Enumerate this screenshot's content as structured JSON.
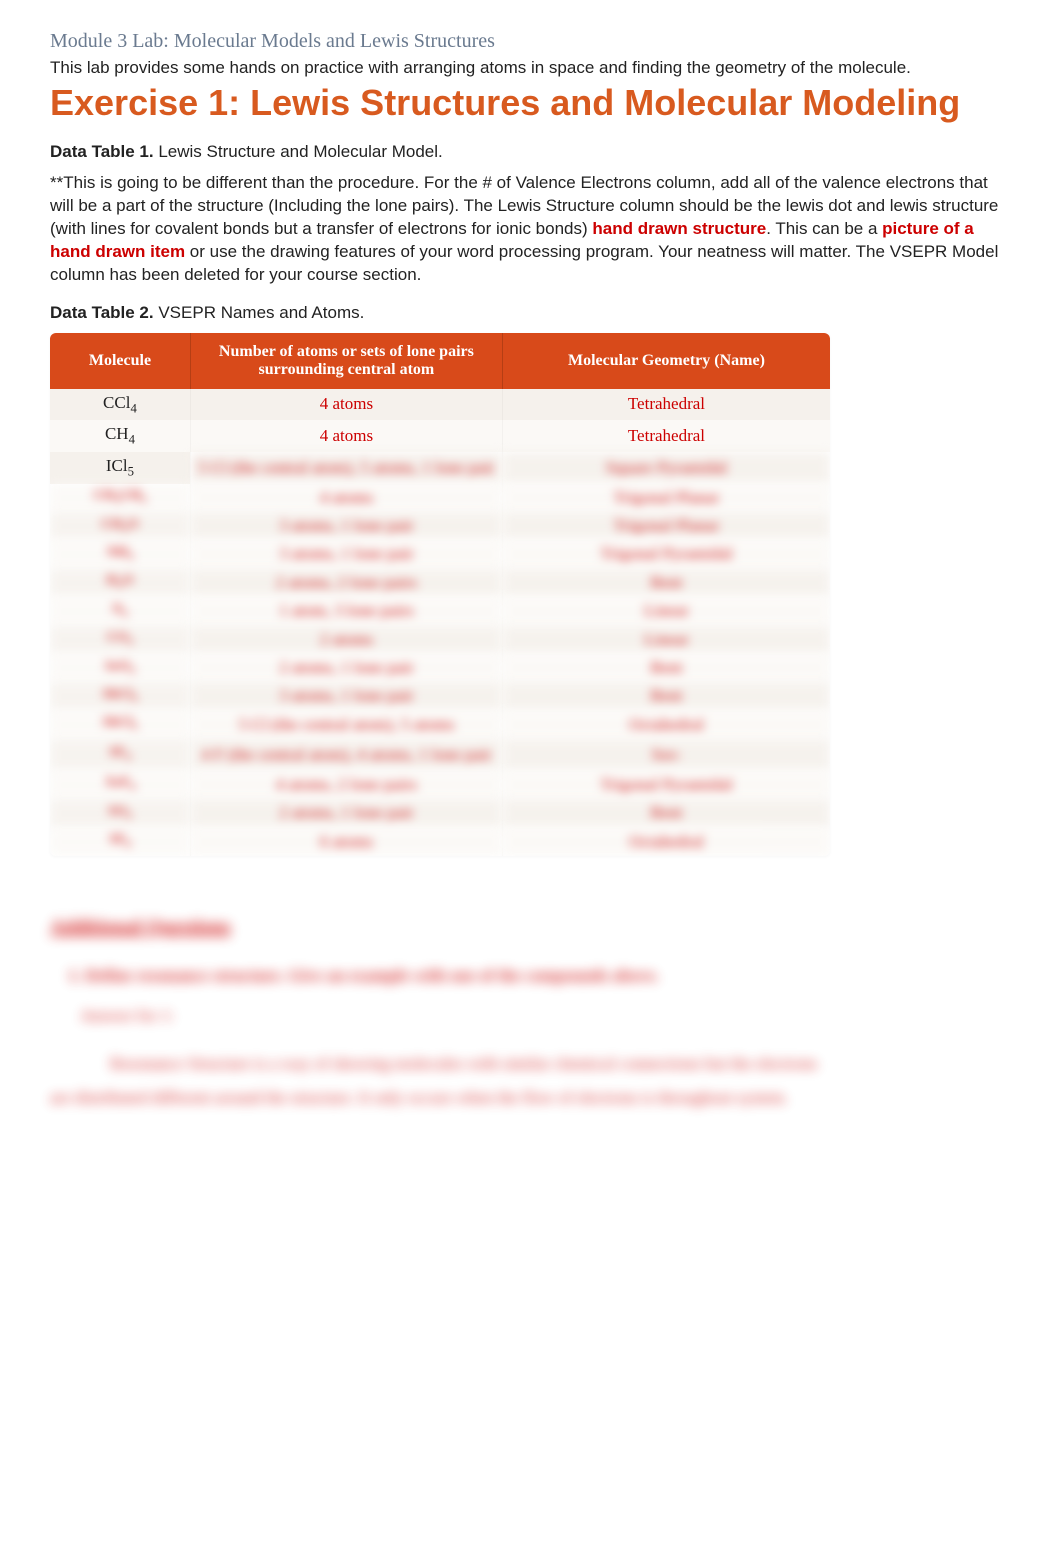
{
  "module_title": "Module 3 Lab: Molecular Models and Lewis Structures",
  "intro": "This lab provides some hands on practice with arranging atoms in space and finding the geometry of the molecule.",
  "exercise_title": "Exercise 1: Lewis Structures and Molecular Modeling",
  "table1_caption_bold": "Data Table 1.",
  "table1_caption_rest": " Lewis Structure and Molecular Model.",
  "instructions_pre": "**This is going to be different than the procedure. For the # of Valence Electrons column, add all of the valence electrons that will be a part of the structure (Including the lone pairs). The Lewis Structure column should be the lewis dot and lewis structure (with lines for covalent bonds but a transfer of electrons for ionic bonds) ",
  "instructions_red1": "hand drawn structure",
  "instructions_mid1": ". This can be a ",
  "instructions_red2": "picture of a hand drawn item",
  "instructions_post": " or use the drawing features of your word processing program. Your neatness will matter.  The VSEPR Model column has been deleted for your course section.",
  "table2_caption_bold": "Data Table 2.",
  "table2_caption_rest": " VSEPR Names and Atoms.",
  "headers": {
    "molecule": "Molecule",
    "number": "Number of atoms or sets of lone pairs surrounding central atom",
    "geometry": "Molecular Geometry  (Name)"
  },
  "rows": [
    {
      "mol_html": "CCl<sub>4</sub>",
      "num": "4 atoms",
      "geo": "Tetrahedral",
      "blurred": false
    },
    {
      "mol_html": "CH<sub>4</sub>",
      "num": "4 atoms",
      "geo": "Tetrahedral",
      "blurred": false
    },
    {
      "mol_html": "ICl<sub>5</sub>",
      "num": "5 Cl (the central atom), 5 atoms, 1 lone pair",
      "geo": "Square Pyramidal",
      "blurred": true,
      "mol_visible": true,
      "two_line": true
    },
    {
      "mol_html": "CH<sub>3</sub>CH<sub>2</sub>",
      "num": "4 atoms",
      "geo": "Trigonal Planar",
      "blurred": true
    },
    {
      "mol_html": "CH<sub>2</sub>O",
      "num": "3 atoms, 1 lone pair",
      "geo": "Trigonal Planar",
      "blurred": true
    },
    {
      "mol_html": "NH<sub>3</sub>",
      "num": "3 atoms, 1 lone pair",
      "geo": "Trigonal Pyramidal",
      "blurred": true
    },
    {
      "mol_html": "H<sub>2</sub>O",
      "num": "2 atoms, 2 lone pairs",
      "geo": "Bent",
      "blurred": true
    },
    {
      "mol_html": "N<sub>2</sub>",
      "num": "1 atom, 3 lone pairs",
      "geo": "Linear",
      "blurred": true
    },
    {
      "mol_html": "CO<sub>2</sub>",
      "num": "2 atoms",
      "geo": "Linear",
      "blurred": true
    },
    {
      "mol_html": "SeO<sub>2</sub>",
      "num": "2 atoms, 1 lone pair",
      "geo": "Bent",
      "blurred": true
    },
    {
      "mol_html": "SbCl<sub>3</sub>",
      "num": "3 atoms, 1 lone pair",
      "geo": "Bent",
      "blurred": true
    },
    {
      "mol_html": "SbCl<sub>5</sub>",
      "num": "5 Cl (the central atom), 5 atoms",
      "geo": "Octahedral",
      "blurred": true
    },
    {
      "mol_html": "SF<sub>4</sub>",
      "num": "4 F (the central atom), 4 atoms, 1 lone pair",
      "geo": "See-",
      "blurred": true,
      "two_line": true
    },
    {
      "mol_html": "XeF<sub>4</sub>",
      "num": "4 atoms, 2 lone pairs",
      "geo": "Trigonal Pyramidal",
      "blurred": true
    },
    {
      "mol_html": "SO<sub>2</sub>",
      "num": "2 atoms, 1 lone pair",
      "geo": "Bent",
      "blurred": true
    },
    {
      "mol_html": "SF<sub>6</sub>",
      "num": "6 atoms",
      "geo": "Octahedral",
      "blurred": true
    }
  ],
  "additional_title": "Additional Questions",
  "q1": "1.  Define resonance structure. Give an example with one of the compounds above.",
  "ans_label": "Answer for 1:",
  "ans_body_line1": "Resonance Structure is a way of showing molecules with similar chemical connections but the electrons",
  "ans_body_line2": "are distributed different around the structure. It only occurs when the flow of electrons is throughout system."
}
